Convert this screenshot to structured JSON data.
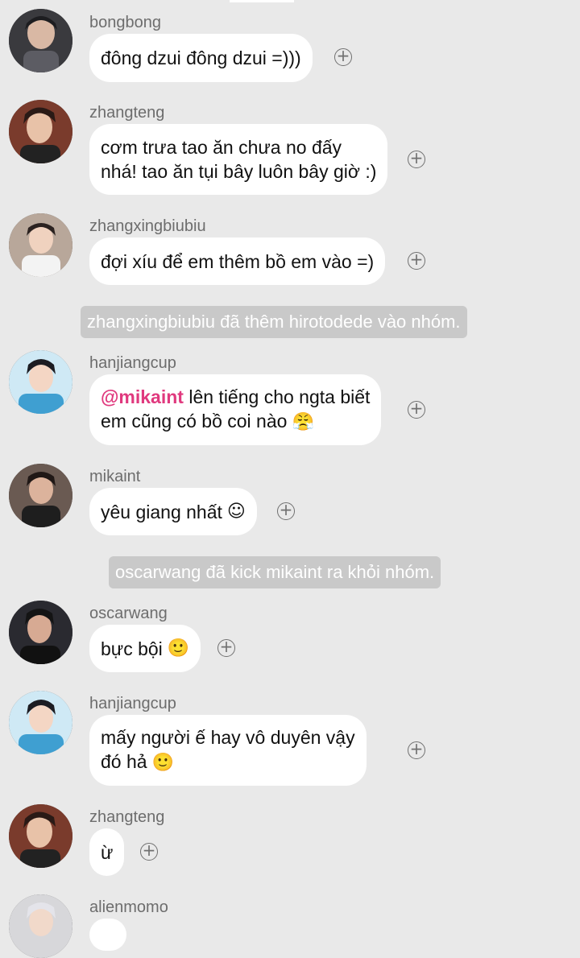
{
  "messages": [
    {
      "user": "bongbong",
      "lines": [
        "đông dzui đông dzui =)))"
      ]
    },
    {
      "user": "zhangteng",
      "lines": [
        "cơm trưa tao ăn chưa no đấy",
        "nhá! tao ăn tụi bây luôn bây giờ :)"
      ]
    },
    {
      "user": "zhangxingbiubiu",
      "lines": [
        "đợi xíu để em thêm bồ em vào =)"
      ]
    },
    {
      "user": "hanjiangcup",
      "mention": "@mikaint",
      "line1_rest": " lên tiếng cho ngta biết",
      "line2": "em cũng có bồ coi nào",
      "emoji": "😤"
    },
    {
      "user": "mikaint",
      "text": "yêu giang nhất",
      "emoji": "☺"
    },
    {
      "user": "oscarwang",
      "text": "bực bội",
      "emoji": "🙂"
    },
    {
      "user": "hanjiangcup",
      "line1": "mấy người ế hay vô duyên vậy",
      "line2": "đó hả",
      "emoji": "🙂"
    },
    {
      "user": "zhangteng",
      "text": "ừ"
    },
    {
      "user": "alienmomo"
    }
  ],
  "system": [
    "zhangxingbiubiu đã thêm hirotodede vào nhóm.",
    "oscarwang đã kick mikaint ra khỏi nhóm."
  ],
  "react_symbol": "+"
}
